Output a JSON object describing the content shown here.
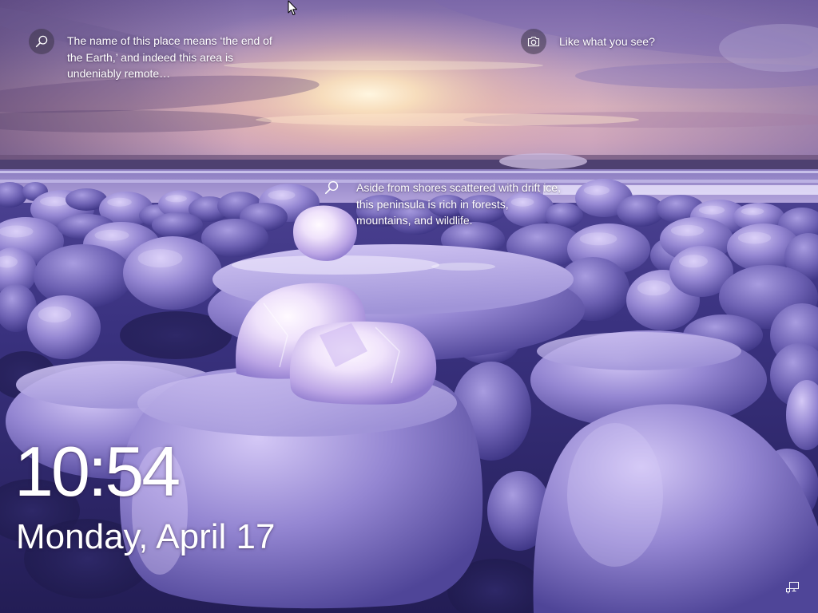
{
  "spotlight": {
    "title_hotspot": {
      "icon": "search-icon",
      "lines": [
        "The name of this place means ‘the end of",
        "the Earth,’ and indeed this area is",
        "undeniably remote…"
      ]
    },
    "feedback": {
      "icon": "camera-icon",
      "text": "Like what you see?"
    },
    "map_hotspot": {
      "icon": "search-icon",
      "lines": [
        "Aside from shores scattered with drift ice,",
        "this peninsula is rich in forests,",
        "mountains, and wildlife."
      ]
    }
  },
  "clock": {
    "time": "10:54",
    "date": "Monday, April 17"
  },
  "system_tray": {
    "network_icon": "network-icon"
  },
  "pointer": {
    "icon": "mouse-pointer-icon"
  },
  "colors": {
    "text": "#ffffff",
    "icon_circle": "#3c3448",
    "ice_tint": "#9486d2",
    "sunset_glow": "#fbe2bc"
  }
}
